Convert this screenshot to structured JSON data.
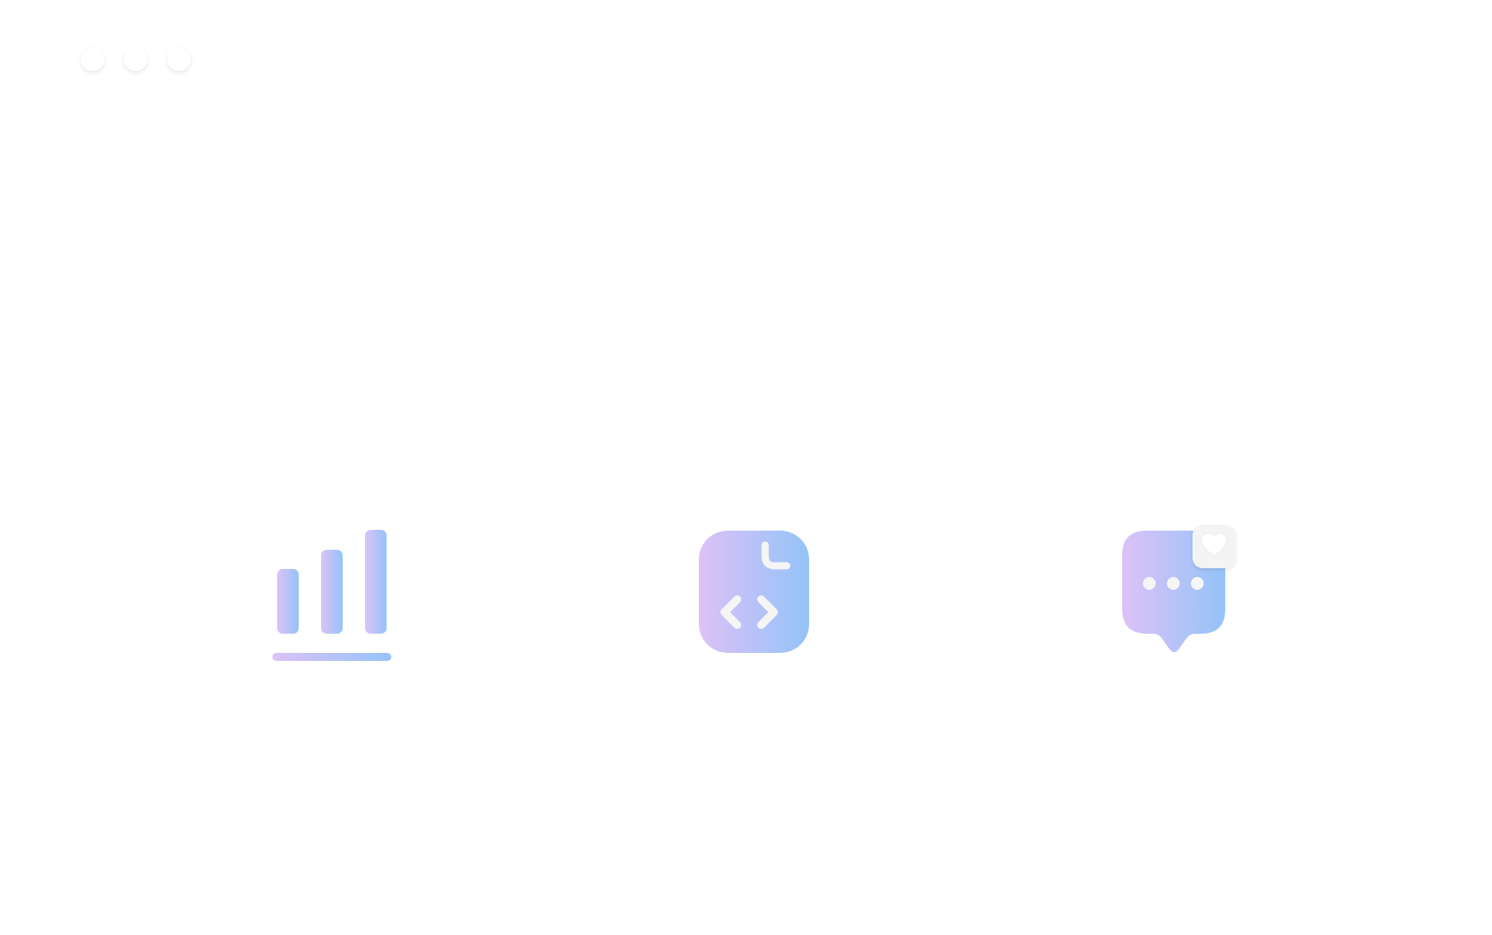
{
  "window": {
    "controls": [
      "close",
      "minimize",
      "maximize"
    ]
  },
  "icons": [
    {
      "name": "bar-chart-icon"
    },
    {
      "name": "code-file-icon"
    },
    {
      "name": "chat-heart-icon"
    }
  ],
  "colors": {
    "gradient_start": "#dcc2f7",
    "gradient_end": "#94c3f8",
    "glyph": "#f5f5f5",
    "badge": "#f4f4f4",
    "window_dot": "#ffffff",
    "background": "#ffffff"
  }
}
